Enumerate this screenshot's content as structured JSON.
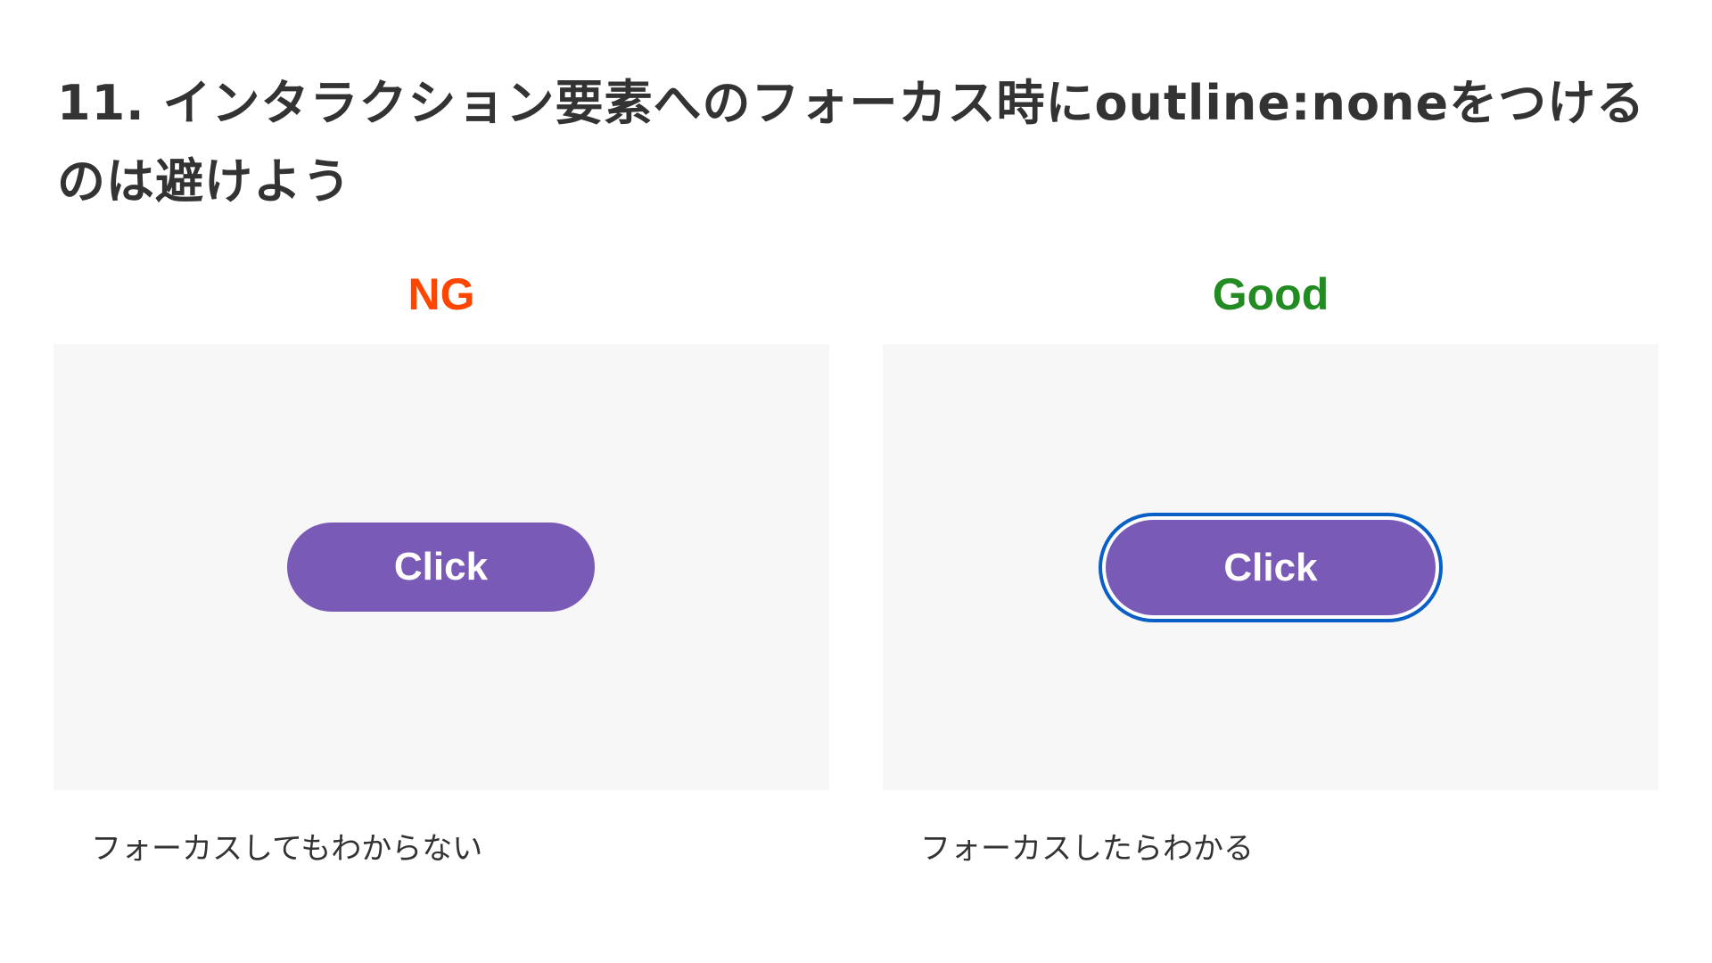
{
  "title": "11. インタラクション要素へのフォーカス時にoutline:noneをつけるのは避けよう",
  "examples": [
    {
      "label": "NG",
      "label_color": "#ff4500",
      "button_label": "Click",
      "caption": "フォーカスしてもわからない"
    },
    {
      "label": "Good",
      "label_color": "#228b22",
      "button_label": "Click",
      "caption": "フォーカスしたらわかる",
      "focus_ring_color": "#0a5fc7"
    }
  ],
  "colors": {
    "button_bg": "#7a5ab7",
    "panel_bg": "#f7f7f7",
    "text": "#333333"
  }
}
